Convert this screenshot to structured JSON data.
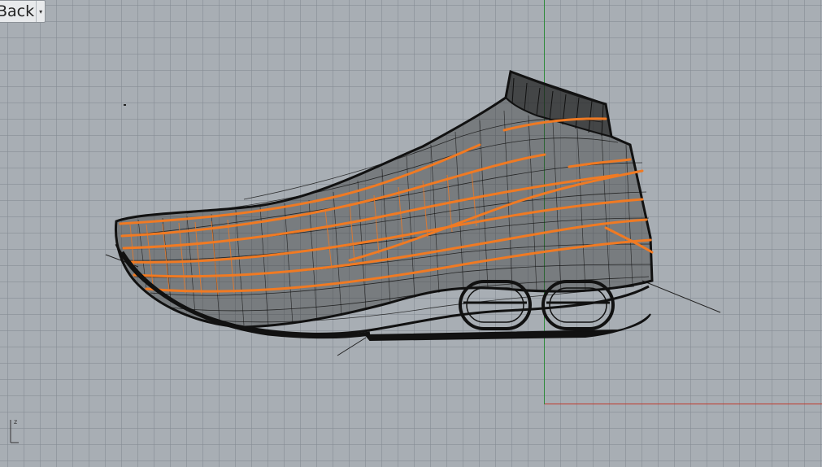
{
  "viewport": {
    "label": "Back",
    "dropdown_icon": "caret-down-icon",
    "axis_label_z": "z",
    "colors": {
      "background": "#a8aeb4",
      "grid": "#828a92",
      "y_axis": "#2f8a3b",
      "x_axis": "#c0392b",
      "wire_black": "#111111",
      "wire_orange": "#f07a23"
    }
  },
  "model": {
    "type": "shoe-wireframe",
    "selected_highlight": "orange"
  }
}
